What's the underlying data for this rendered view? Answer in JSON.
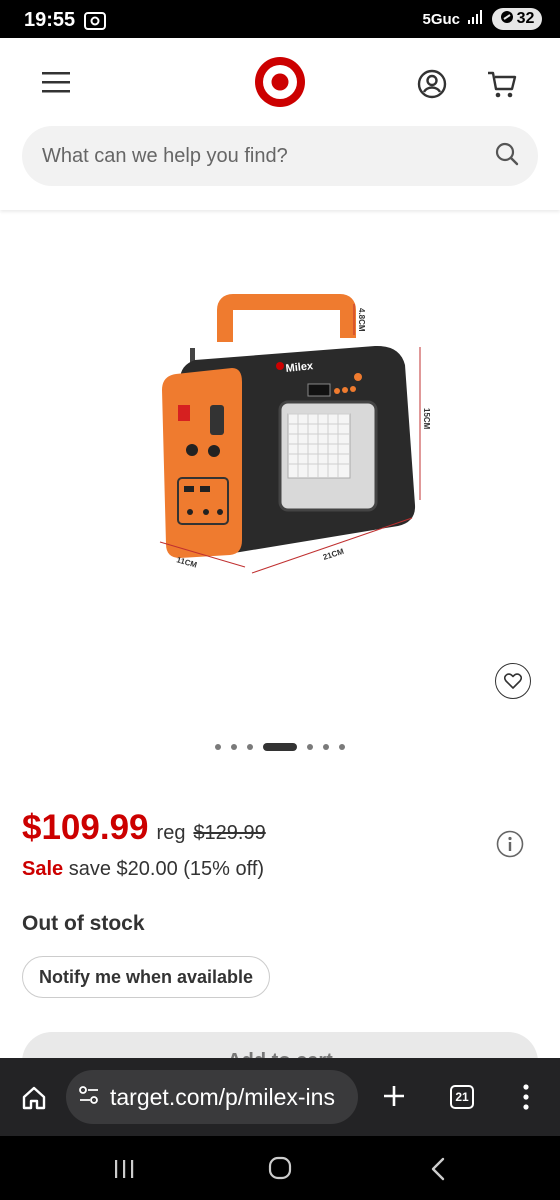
{
  "status_bar": {
    "time": "19:55",
    "network": "5Guc",
    "battery": "32"
  },
  "header": {
    "search_placeholder": "What can we help you find?"
  },
  "product": {
    "price": "$109.99",
    "reg_label": "reg",
    "reg_price": "$129.99",
    "sale_label": "Sale",
    "save_text": "save $20.00 (15% off)",
    "stock_status": "Out of stock",
    "notify_label": "Notify me when available",
    "add_to_cart_label": "Add to cart",
    "image_count": 7,
    "active_image": 4,
    "image_labels": {
      "brand": "Milex",
      "height": "4.8CM",
      "depth": "15CM",
      "width": "21CM",
      "length": "11CM"
    }
  },
  "browser": {
    "url": "target.com/p/milex-ins",
    "tab_count": "21"
  },
  "colors": {
    "brand_red": "#cc0000",
    "orange": "#ef7b2f"
  }
}
